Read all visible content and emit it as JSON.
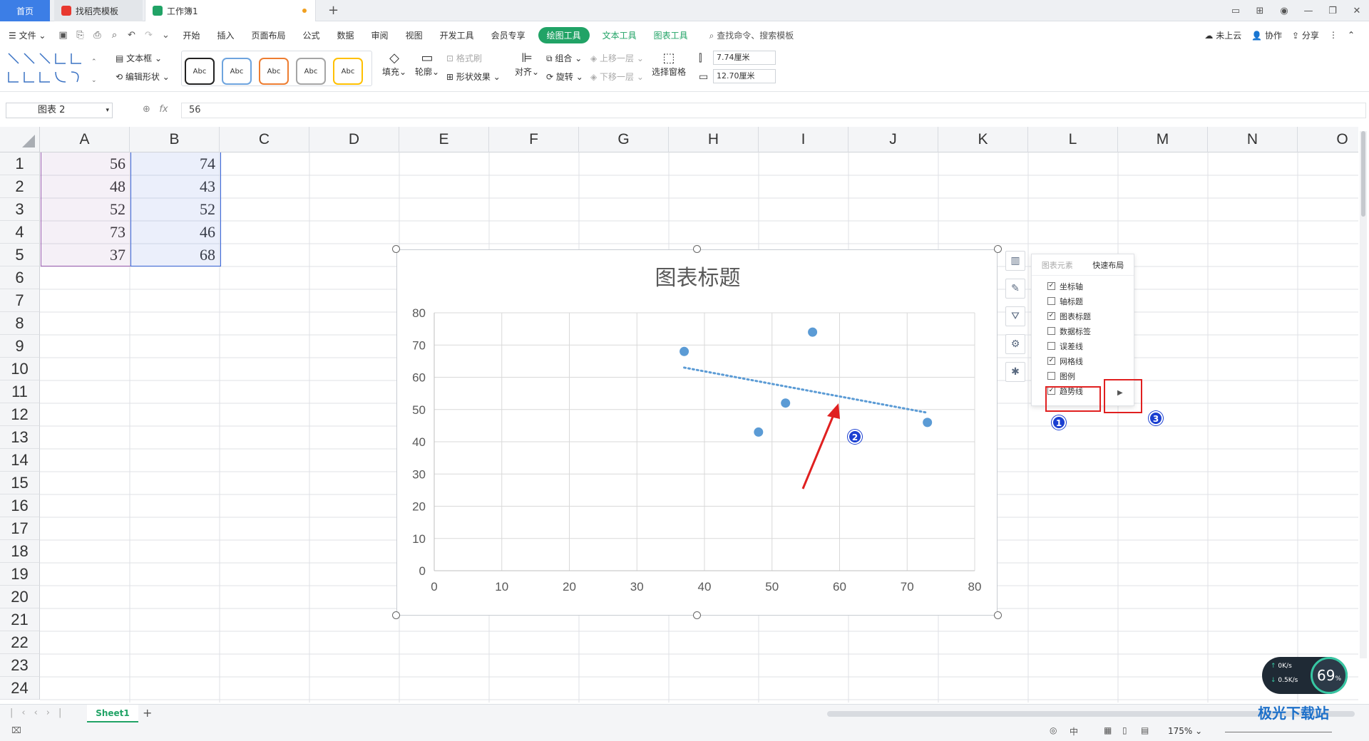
{
  "tabs": {
    "home": "首页",
    "template": "找稻壳模板",
    "workbook": "工作簿1"
  },
  "menu": {
    "file": "文件",
    "items": [
      "开始",
      "插入",
      "页面布局",
      "公式",
      "数据",
      "审阅",
      "视图",
      "开发工具",
      "会员专享"
    ],
    "active_tool": "绘图工具",
    "text_tool": "文本工具",
    "chart_tool": "图表工具",
    "search": "查找命令、搜索模板",
    "cloud": "未上云",
    "collab": "协作",
    "share": "分享"
  },
  "ribbon": {
    "textbox": "文本框",
    "edit_shape": "编辑形状",
    "style_sample": "Abc",
    "fill": "填充",
    "outline": "轮廓",
    "format_painter": "格式刷",
    "shape_effect": "形状效果",
    "align": "对齐",
    "group": "组合",
    "rotate": "旋转",
    "bring_forward": "上移一层",
    "send_backward": "下移一层",
    "selection_pane": "选择窗格",
    "height": "7.74厘米",
    "width": "12.70厘米"
  },
  "formula": {
    "name_box": "图表 2",
    "fx": "fx",
    "value": "56"
  },
  "columns": [
    "A",
    "B",
    "C",
    "D",
    "E",
    "F",
    "G",
    "H",
    "I",
    "J",
    "K",
    "L",
    "M",
    "N",
    "O"
  ],
  "rows": [
    "1",
    "2",
    "3",
    "4",
    "5",
    "6",
    "7",
    "8",
    "9",
    "10",
    "11",
    "12",
    "13",
    "14",
    "15",
    "16",
    "17",
    "18",
    "19",
    "20",
    "21",
    "22",
    "23",
    "24"
  ],
  "cells": {
    "A": [
      "56",
      "48",
      "52",
      "73",
      "37"
    ],
    "B": [
      "74",
      "43",
      "52",
      "46",
      "68"
    ]
  },
  "chart_data": {
    "type": "scatter",
    "title": "图表标题",
    "x": [
      56,
      48,
      52,
      73,
      37
    ],
    "y": [
      74,
      43,
      52,
      46,
      68
    ],
    "xlim": [
      0,
      80
    ],
    "ylim": [
      0,
      80
    ],
    "xticks": [
      "0",
      "10",
      "20",
      "30",
      "40",
      "50",
      "60",
      "70",
      "80"
    ],
    "yticks": [
      "0",
      "10",
      "20",
      "30",
      "40",
      "50",
      "60",
      "70",
      "80"
    ],
    "trendline": {
      "x": [
        37,
        73
      ],
      "y": [
        63,
        49
      ]
    },
    "grid": true,
    "point_color": "#5b9bd5"
  },
  "chart_elements_panel": {
    "tab_elements": "图表元素",
    "tab_quick_layout": "快速布局",
    "options": [
      {
        "label": "坐标轴",
        "checked": true
      },
      {
        "label": "轴标题",
        "checked": false
      },
      {
        "label": "图表标题",
        "checked": true
      },
      {
        "label": "数据标签",
        "checked": false
      },
      {
        "label": "误差线",
        "checked": false
      },
      {
        "label": "网格线",
        "checked": true
      },
      {
        "label": "图例",
        "checked": false
      },
      {
        "label": "趋势线",
        "checked": true
      }
    ]
  },
  "annotations": {
    "badge1": "1",
    "badge2": "2",
    "badge3": "3"
  },
  "sheet": {
    "name": "Sheet1"
  },
  "status": {
    "zoom": "175%"
  },
  "net": {
    "up": "0K/s",
    "down": "0.5K/s",
    "percent": "69"
  },
  "watermark": "极光下载站",
  "colors": {
    "accent": "#21a366",
    "tab_home": "#3c7ee6",
    "annotation_red": "#e02020",
    "badge_blue": "#1a3fd1"
  }
}
